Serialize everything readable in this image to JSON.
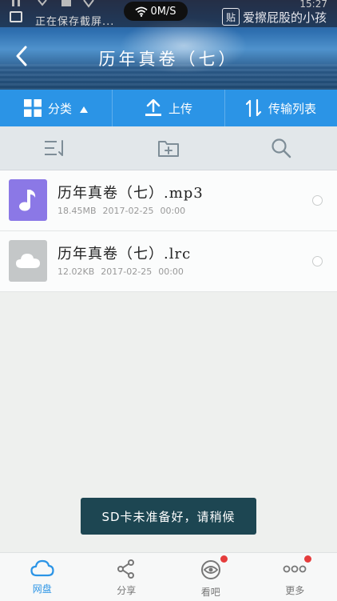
{
  "status_bar": {
    "notification_text": "正在保存截屏...",
    "network_speed": "0M/S",
    "clock": "15:27"
  },
  "watermark": {
    "badge": "贴",
    "text": "爱擦屁股的小孩"
  },
  "header": {
    "title": "历年真卷（七）"
  },
  "action_bar": {
    "category_label": "分类",
    "upload_label": "上传",
    "transfer_label": "传输列表"
  },
  "files": [
    {
      "name": "历年真卷（七）.mp3",
      "size": "18.45MB",
      "date": "2017-02-25",
      "time": "00:00",
      "icon": "music-file-icon"
    },
    {
      "name": "历年真卷（七）.lrc",
      "size": "12.02KB",
      "date": "2017-02-25",
      "time": "00:00",
      "icon": "cloud-file-icon"
    }
  ],
  "toast": {
    "text": "SD卡未准备好，请稍候"
  },
  "bottom_nav": {
    "items": [
      {
        "label": "网盘",
        "icon": "cloud-icon",
        "active": true,
        "badge": false
      },
      {
        "label": "分享",
        "icon": "share-icon",
        "active": false,
        "badge": false
      },
      {
        "label": "看吧",
        "icon": "eye-icon",
        "active": false,
        "badge": true
      },
      {
        "label": "更多",
        "icon": "more-dots-icon",
        "active": false,
        "badge": true
      }
    ]
  },
  "colors": {
    "accent": "#2b94e6",
    "toast_bg": "#1d4652",
    "badge_red": "#e53c3c",
    "music_thumb": "#8b78e6"
  }
}
